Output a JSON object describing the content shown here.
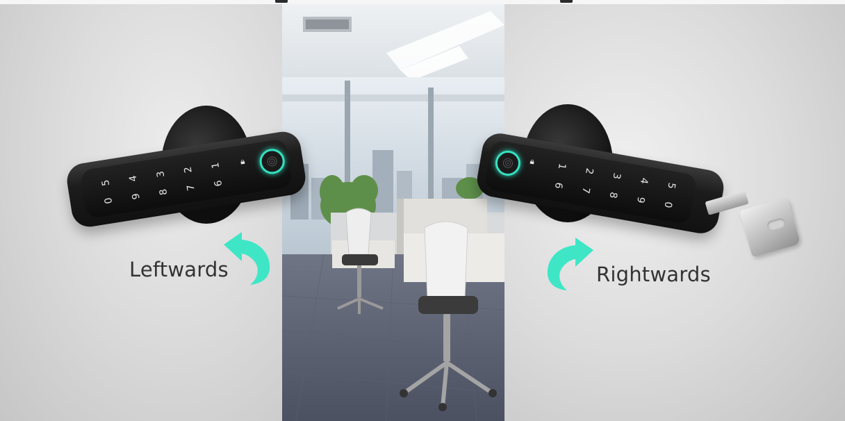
{
  "left_label": "Leftwards",
  "right_label": "Rightwards",
  "left_lock": {
    "keypad_top_row": [
      "5",
      "4",
      "3",
      "2",
      "1"
    ],
    "keypad_bottom_row": [
      "0",
      "9",
      "8",
      "7",
      "6"
    ]
  },
  "right_lock": {
    "keypad_top_row": [
      "1",
      "2",
      "3",
      "4",
      "5"
    ],
    "keypad_bottom_row": [
      "6",
      "7",
      "8",
      "9",
      "0"
    ]
  },
  "colors": {
    "arrow": "#3ee6c6",
    "fingerprint_ring": "#35e0c0",
    "lock_body": "#141414"
  },
  "icons": [
    "curved-arrow-left-icon",
    "curved-arrow-right-icon",
    "fingerprint-sensor-icon",
    "padlock-icon",
    "key-icon"
  ]
}
